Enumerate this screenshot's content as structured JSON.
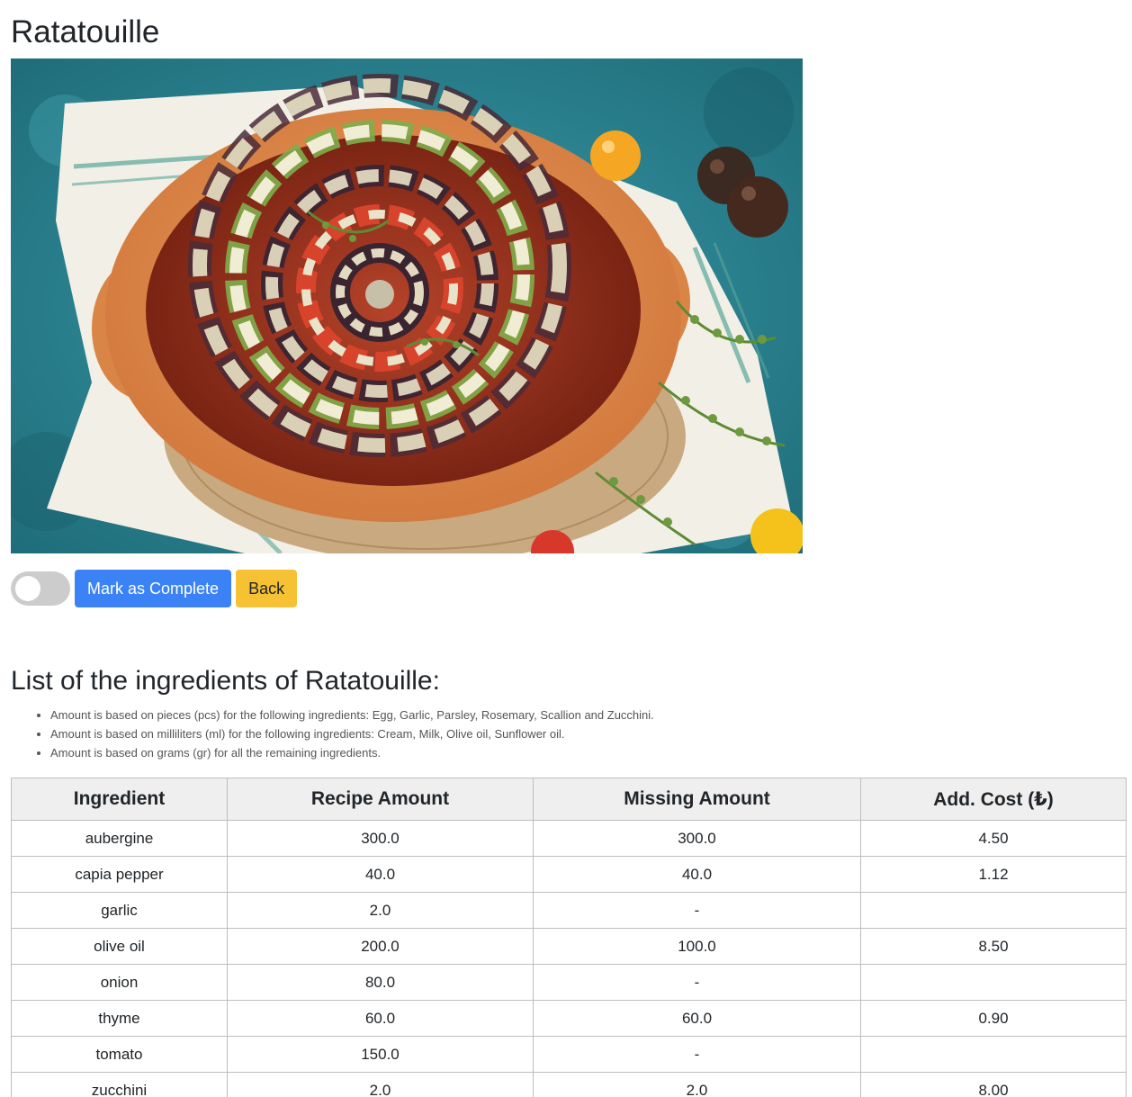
{
  "recipe": {
    "title": "Ratatouille",
    "image_alt": "Ratatouille in a terracotta baking dish"
  },
  "controls": {
    "toggle_on": false,
    "complete_label": "Mark as Complete",
    "back_label": "Back"
  },
  "ingredients_section": {
    "heading": "List of the ingredients of Ratatouille:",
    "notes": [
      "Amount is based on pieces (pcs) for the following ingredients: Egg, Garlic, Parsley, Rosemary, Scallion and Zucchini.",
      "Amount is based on milliliters (ml) for the following ingredients: Cream, Milk, Olive oil, Sunflower oil.",
      "Amount is based on grams (gr) for all the remaining ingredients."
    ]
  },
  "table": {
    "headers": [
      "Ingredient",
      "Recipe Amount",
      "Missing Amount",
      "Add. Cost (₺)"
    ],
    "rows": [
      [
        "aubergine",
        "300.0",
        "300.0",
        "4.50"
      ],
      [
        "capia pepper",
        "40.0",
        "40.0",
        "1.12"
      ],
      [
        "garlic",
        "2.0",
        "-",
        ""
      ],
      [
        "olive oil",
        "200.0",
        "100.0",
        "8.50"
      ],
      [
        "onion",
        "80.0",
        "-",
        ""
      ],
      [
        "thyme",
        "60.0",
        "60.0",
        "0.90"
      ],
      [
        "tomato",
        "150.0",
        "-",
        ""
      ],
      [
        "zucchini",
        "2.0",
        "2.0",
        "8.00"
      ]
    ]
  },
  "colors": {
    "primary": "#3b82f6",
    "warning": "#f6c233",
    "toggle_off": "#cccccc"
  }
}
